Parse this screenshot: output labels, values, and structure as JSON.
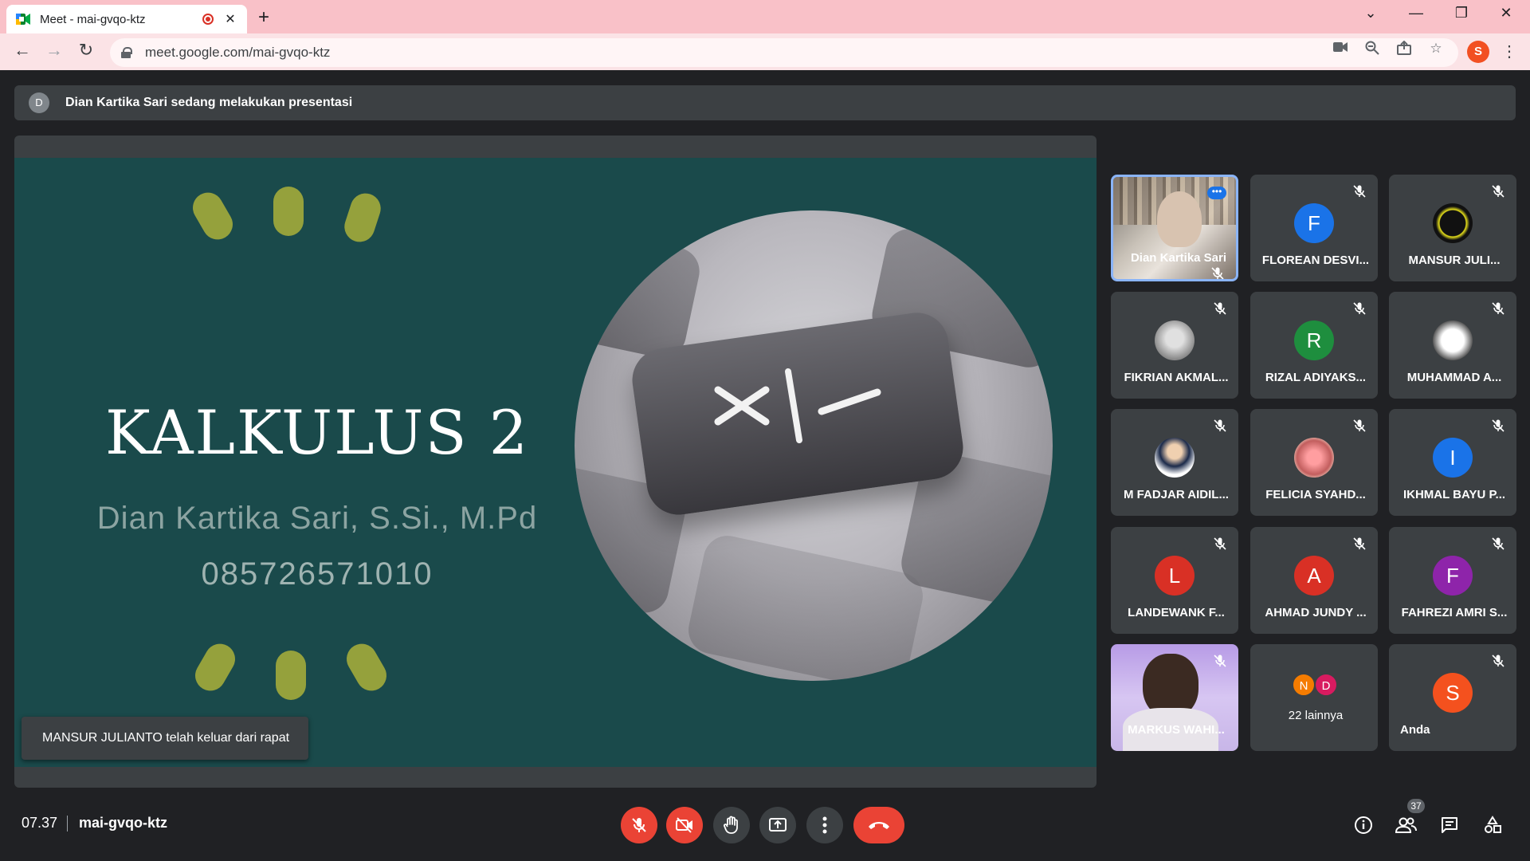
{
  "browser": {
    "tab_title": "Meet - mai-gvqo-ktz",
    "url": "meet.google.com/mai-gvqo-ktz",
    "profile_initial": "S"
  },
  "banner": {
    "avatar_initial": "D",
    "text": "Dian Kartika Sari sedang melakukan presentasi"
  },
  "slide": {
    "title": "KALKULUS 2",
    "presenter": "Dian Kartika Sari, S.Si., M.Pd",
    "phone": "085726571010"
  },
  "toast": "MANSUR JULIANTO telah keluar dari rapat",
  "participants": [
    {
      "name": "Dian Kartika Sari",
      "type": "video"
    },
    {
      "name": "FLOREAN DESVI...",
      "initial": "F",
      "color": "#1a73e8"
    },
    {
      "name": "MANSUR JULI...",
      "type": "image"
    },
    {
      "name": "FIKRIAN AKMAL...",
      "type": "image"
    },
    {
      "name": "RIZAL ADIYAKS...",
      "initial": "R",
      "color": "#1e8e3e"
    },
    {
      "name": "MUHAMMAD A...",
      "type": "image"
    },
    {
      "name": "M FADJAR AIDIL...",
      "type": "image"
    },
    {
      "name": "FELICIA SYAHD...",
      "type": "image"
    },
    {
      "name": "IKHMAL BAYU P...",
      "initial": "I",
      "color": "#1a73e8"
    },
    {
      "name": "LANDEWANK F...",
      "initial": "L",
      "color": "#d93025"
    },
    {
      "name": "AHMAD JUNDY ...",
      "initial": "A",
      "color": "#d93025"
    },
    {
      "name": "FAHREZI AMRI S...",
      "initial": "F",
      "color": "#8e24aa"
    },
    {
      "name": "MARKUS WAHI...",
      "type": "video"
    },
    {
      "name": "22 lainnya",
      "initials": [
        "N",
        "D"
      ]
    },
    {
      "name": "Anda",
      "initial": "S",
      "color": "#f4511e"
    }
  ],
  "bottom": {
    "time": "07.37",
    "meeting_code": "mai-gvqo-ktz",
    "people_count": "37"
  }
}
